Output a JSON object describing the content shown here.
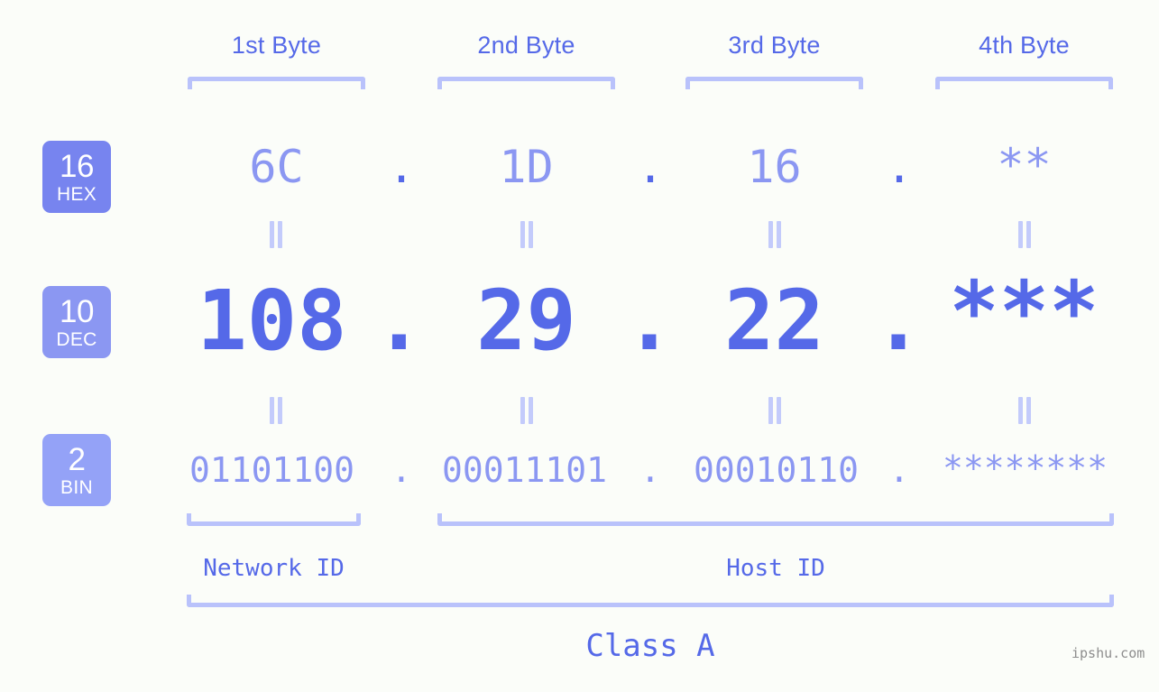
{
  "background_color": "#fbfdf9",
  "accent_dark": "#5569e8",
  "accent_mid": "#8b97f2",
  "accent_light": "#b9c2fb",
  "byte_headers": [
    {
      "label": "1st Byte"
    },
    {
      "label": "2nd Byte"
    },
    {
      "label": "3rd Byte"
    },
    {
      "label": "4th Byte"
    }
  ],
  "rows": [
    {
      "badge_number": "16",
      "badge_name": "HEX",
      "badge_color": "#7784ef",
      "values": [
        "6C",
        "1D",
        "16",
        "**"
      ],
      "separator": "."
    },
    {
      "badge_number": "10",
      "badge_name": "DEC",
      "badge_color": "#8b97f2",
      "values": [
        "108",
        "29",
        "22",
        "***"
      ],
      "separator": "."
    },
    {
      "badge_number": "2",
      "badge_name": "BIN",
      "badge_color": "#94a2f7",
      "values": [
        "01101100",
        "00011101",
        "00010110",
        "********"
      ],
      "separator": "."
    }
  ],
  "equals_symbol": "=",
  "id_sections": [
    {
      "label": "Network ID"
    },
    {
      "label": "Host ID"
    }
  ],
  "class_label": "Class A",
  "watermark": "ipshu.com"
}
